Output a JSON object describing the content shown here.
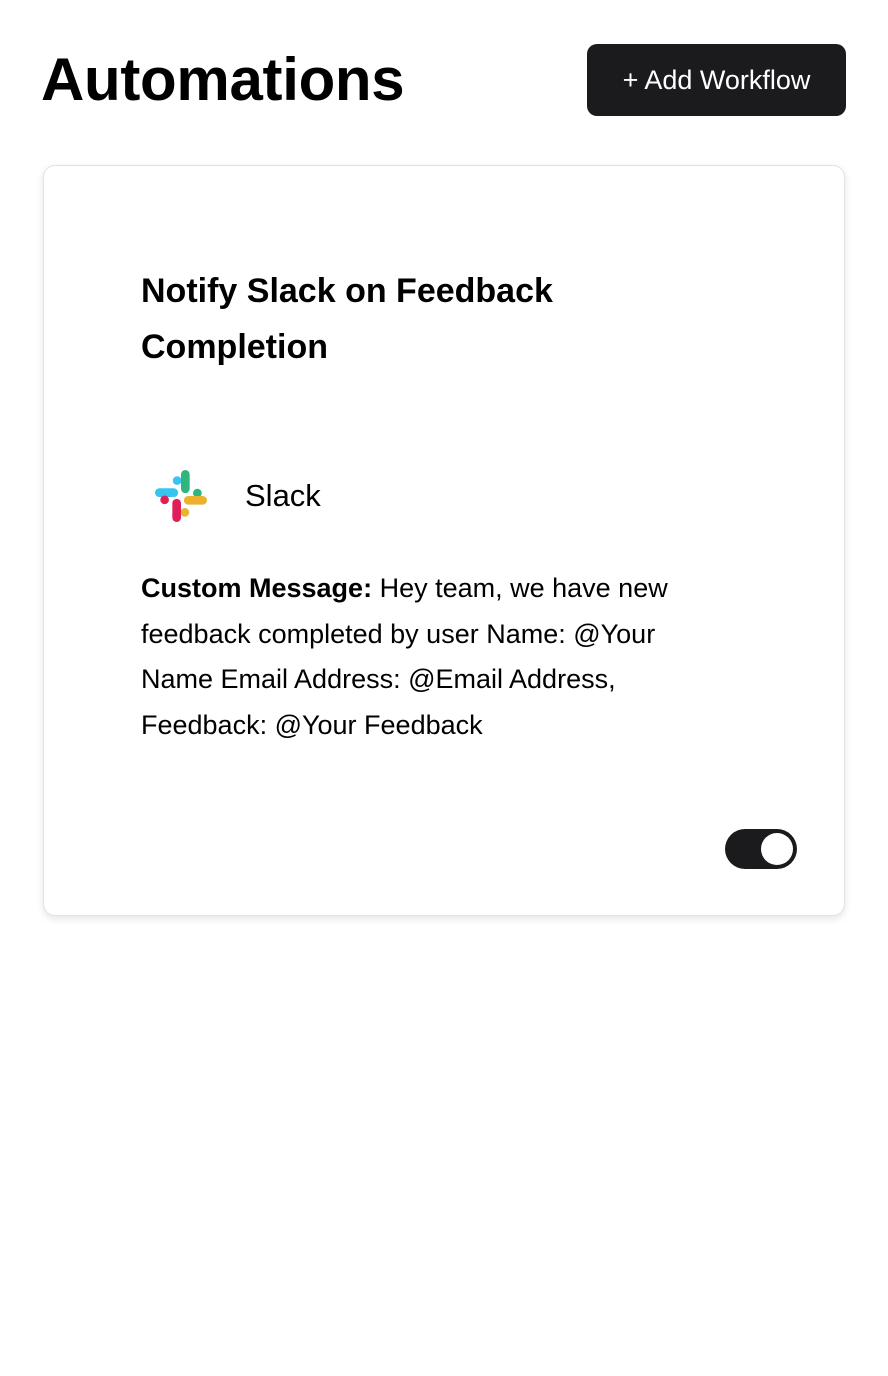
{
  "header": {
    "title": "Automations",
    "add_button_label": "+ Add Workflow"
  },
  "workflow": {
    "title": "Notify Slack on Feedback Completion",
    "integration": {
      "name": "Slack",
      "icon": "slack-icon"
    },
    "message_label": "Custom Message:",
    "message_text": " Hey team, we have new feedback completed by user Name: @Your Name Email Address: @Email Address, Feedback: @Your Feedback",
    "enabled": true
  },
  "colors": {
    "primary": "#1b1b1d",
    "card_border": "#e2e2e2",
    "slack_blue": "#36C5F0",
    "slack_green": "#2EB67D",
    "slack_yellow": "#ECB22E",
    "slack_red": "#E01E5A"
  }
}
